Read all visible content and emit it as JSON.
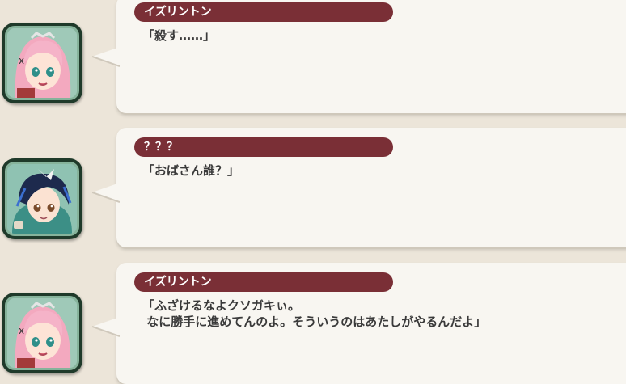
{
  "messages": [
    {
      "speaker": "イズリントン",
      "avatar": "izlington-portrait-icon",
      "lines": [
        "「殺す……」"
      ]
    },
    {
      "speaker": "？？？",
      "avatar": "unknown-character-portrait-icon",
      "lines": [
        "「おばさん誰？」"
      ]
    },
    {
      "speaker": "イズリントン",
      "avatar": "izlington-portrait-icon",
      "lines": [
        "「ふざけるなよクソガキぃ。",
        " なに勝手に進めてんのよ。そういうのはあたしがやるんだよ」"
      ]
    }
  ],
  "colors": {
    "background": "#ece5d9",
    "bubble": "#f8f6f1",
    "nameplate": "#7a2f36",
    "avatar_frame": "#1f3a2a",
    "avatar_border": "#86b39b"
  }
}
